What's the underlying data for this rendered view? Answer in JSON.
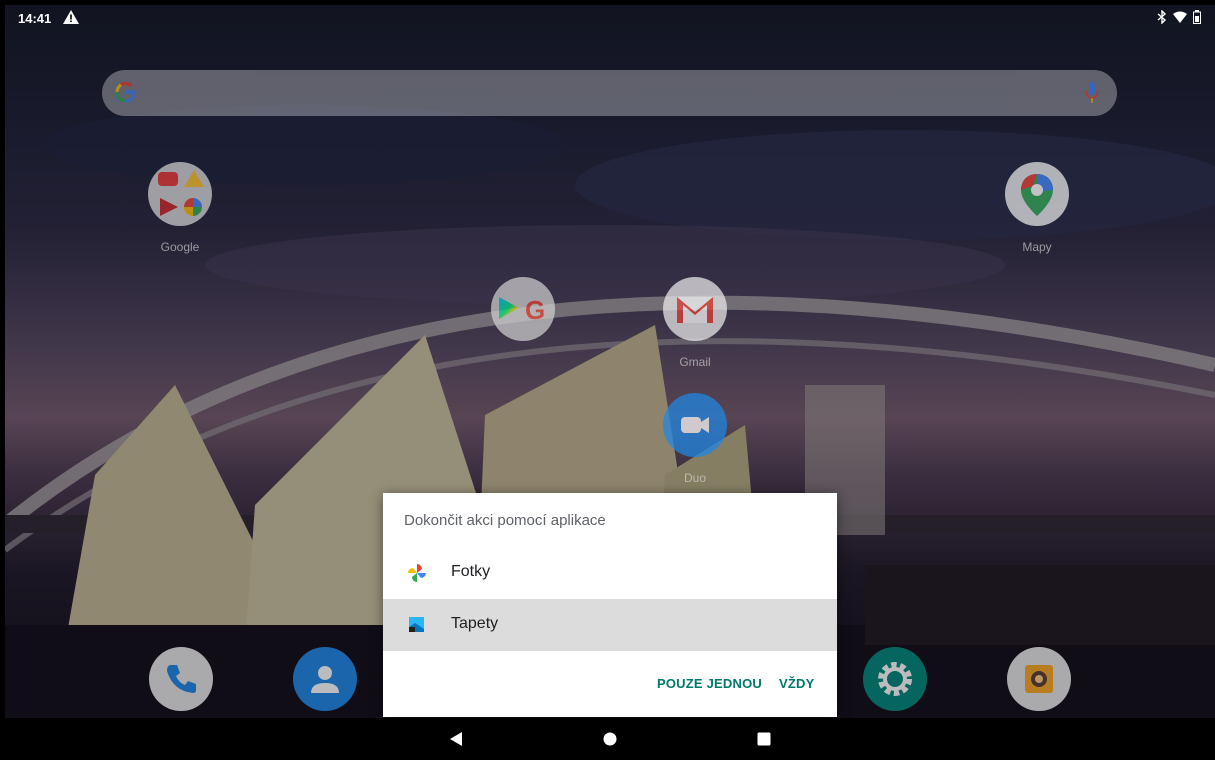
{
  "statusbar": {
    "time": "14:41"
  },
  "search": {
    "engine_logo": "google-logo",
    "mic": "mic-icon"
  },
  "apps": [
    {
      "id": "google",
      "label": "Google"
    },
    {
      "id": "mapy",
      "label": "Mapy"
    },
    {
      "id": "play-google",
      "label": ""
    },
    {
      "id": "gmail",
      "label": "Gmail"
    },
    {
      "id": "duo",
      "label": "Duo"
    }
  ],
  "dock": [
    "phone-icon",
    "contacts-icon",
    "settings-icon",
    "camera-icon"
  ],
  "dialog": {
    "title": "Dokončit akci pomocí aplikace",
    "options": [
      {
        "label": "Fotky",
        "icon": "photos-pinwheel-icon"
      },
      {
        "label": "Tapety",
        "icon": "wallpapers-icon",
        "selected": true
      }
    ],
    "just_once": "POUZE JEDNOU",
    "always": "VŽDY"
  },
  "colors": {
    "accent": "#00796b",
    "selected_row": "#dcdcdc"
  }
}
